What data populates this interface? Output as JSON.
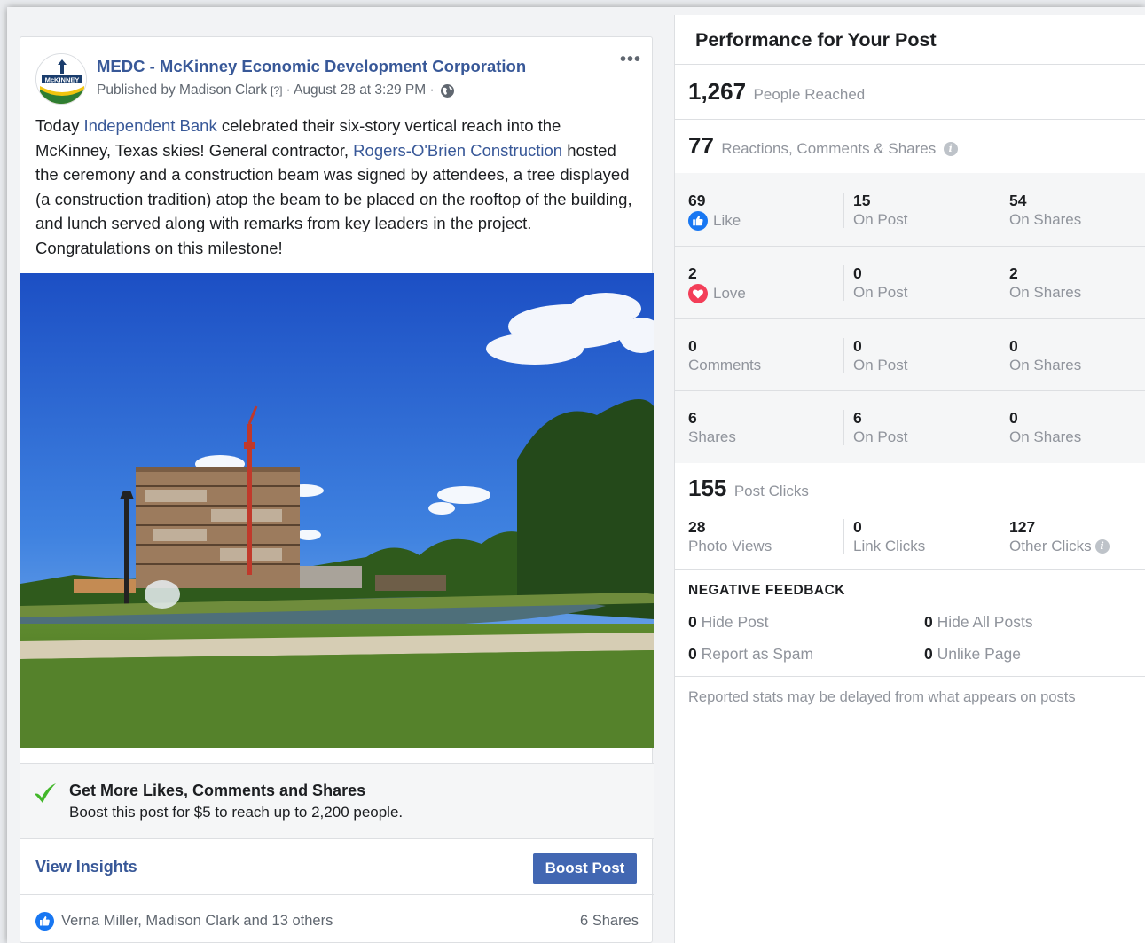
{
  "post": {
    "page_name": "MEDC - McKinney Economic Development Corporation",
    "published_by": "Published by Madison Clark",
    "help_marker": "[?]",
    "date": "· August 28 at 3:29 PM ·",
    "more_label": "•••",
    "avatar_text": "McKINNEY",
    "text_before_link1": "Today ",
    "link1": "Independent Bank",
    "text_after_link1": " celebrated their six-story vertical reach into the McKinney, Texas skies! General contractor, ",
    "link2": "Rogers-O'Brien Construction",
    "text_after_link2": " hosted the ceremony and a construction beam was signed by attendees, a tree displayed (a construction tradition) atop the beam to be placed on the rooftop of the building, and lunch served along with remarks from key leaders in the project. Congratulations on this milestone!",
    "promo_title": "Get More Likes, Comments and Shares",
    "promo_sub": "Boost this post for $5 to reach up to 2,200 people.",
    "view_insights": "View Insights",
    "boost_button": "Boost Post",
    "reactions_text": "Verna Miller, Madison Clark and 13 others",
    "shares_text": "6 Shares"
  },
  "panel": {
    "title": "Performance for Your Post",
    "reached": {
      "num": "1,267",
      "label": "People Reached"
    },
    "engagement": {
      "num": "77",
      "label": "Reactions, Comments & Shares"
    },
    "grid": [
      {
        "a_num": "69",
        "a_label": "Like",
        "b_num": "15",
        "b_label": "On Post",
        "c_num": "54",
        "c_label": "On Shares"
      },
      {
        "a_num": "2",
        "a_label": "Love",
        "b_num": "0",
        "b_label": "On Post",
        "c_num": "2",
        "c_label": "On Shares"
      },
      {
        "a_num": "0",
        "a_label": "Comments",
        "b_num": "0",
        "b_label": "On Post",
        "c_num": "0",
        "c_label": "On Shares"
      },
      {
        "a_num": "6",
        "a_label": "Shares",
        "b_num": "6",
        "b_label": "On Post",
        "c_num": "0",
        "c_label": "On Shares"
      }
    ],
    "clicks": {
      "num": "155",
      "label": "Post Clicks"
    },
    "click_breakdown": [
      {
        "num": "28",
        "label": "Photo Views"
      },
      {
        "num": "0",
        "label": "Link Clicks"
      },
      {
        "num": "127",
        "label": "Other Clicks"
      }
    ],
    "negative_title": "NEGATIVE FEEDBACK",
    "negative": [
      {
        "num": "0",
        "label": "Hide Post"
      },
      {
        "num": "0",
        "label": "Hide All Posts"
      },
      {
        "num": "0",
        "label": "Report as Spam"
      },
      {
        "num": "0",
        "label": "Unlike Page"
      }
    ],
    "footnote": "Reported stats may be delayed from what appears on posts",
    "info_glyph": "i"
  },
  "colors": {
    "link": "#385898",
    "button": "#4267b2",
    "like_blue": "#1877f2",
    "love_red": "#f33e58",
    "check_green": "#42b72a",
    "muted": "#90949c"
  }
}
